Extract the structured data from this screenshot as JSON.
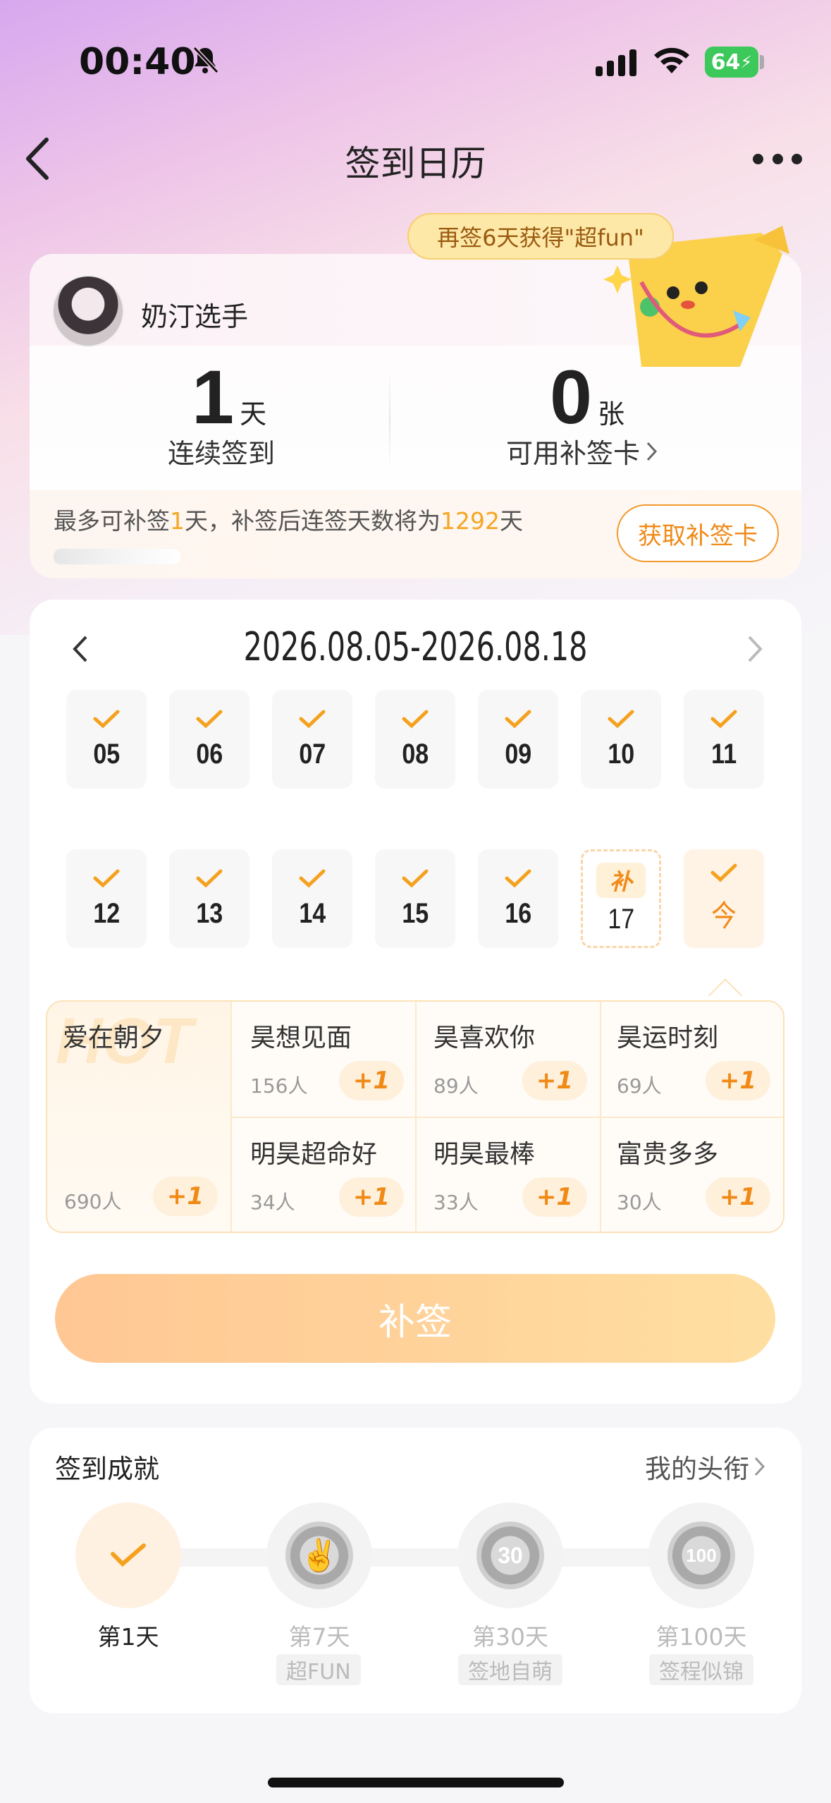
{
  "status_bar": {
    "time": "00:40",
    "battery": "64"
  },
  "nav": {
    "title": "签到日历"
  },
  "bubble": {
    "text": "再签6天获得\"超fun\""
  },
  "user": {
    "name": "奶汀选手",
    "streak_value": "1",
    "streak_unit": "天",
    "streak_label": "连续签到",
    "cards_value": "0",
    "cards_unit": "张",
    "cards_label": "可用补签卡",
    "info_prefix": "最多可补签",
    "info_days": "1",
    "info_mid": "天，补签后连签天数将为",
    "info_total": "1292",
    "info_suffix": "天",
    "get_card_button": "获取补签卡"
  },
  "calendar": {
    "range": "2026.08.05-2026.08.18",
    "row1": [
      "05",
      "06",
      "07",
      "08",
      "09",
      "10",
      "11"
    ],
    "row2": [
      "12",
      "13",
      "14",
      "15",
      "16"
    ],
    "makeup_day": {
      "tag": "补",
      "num": "17"
    },
    "today": {
      "label": "今"
    }
  },
  "phrases": {
    "hot_word": "HOT",
    "featured": {
      "name": "爱在朝夕",
      "count": "690人",
      "action": "+1"
    },
    "items": [
      {
        "name": "昊想见面",
        "count": "156人",
        "action": "+1"
      },
      {
        "name": "昊喜欢你",
        "count": "89人",
        "action": "+1"
      },
      {
        "name": "昊运时刻",
        "count": "69人",
        "action": "+1"
      },
      {
        "name": "明昊超命好",
        "count": "34人",
        "action": "+1"
      },
      {
        "name": "明昊最棒",
        "count": "33人",
        "action": "+1"
      },
      {
        "name": "富贵多多",
        "count": "30人",
        "action": "+1"
      }
    ]
  },
  "makeup_button": "补签",
  "achievements": {
    "title": "签到成就",
    "link": "我的头衔",
    "items": [
      {
        "day": "第1天",
        "tag": "",
        "badge": "",
        "done": true
      },
      {
        "day": "第7天",
        "tag": "超FUN",
        "badge": "",
        "done": false
      },
      {
        "day": "第30天",
        "tag": "签地自萌",
        "badge": "30",
        "done": false
      },
      {
        "day": "第100天",
        "tag": "签程似锦",
        "badge": "100",
        "done": false
      }
    ]
  },
  "colors": {
    "accent": "#f08a17",
    "check": "#f5a11e",
    "battery": "#3cc85a"
  }
}
